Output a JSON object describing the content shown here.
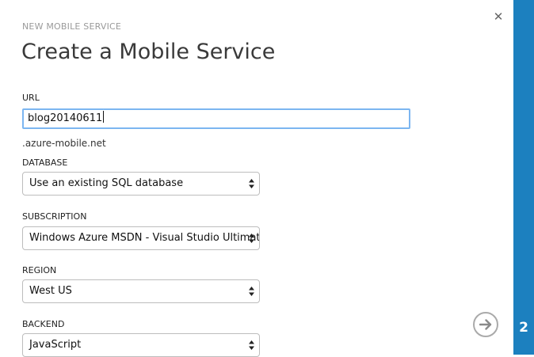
{
  "dialog": {
    "header": "NEW MOBILE SERVICE",
    "title": "Create a Mobile Service",
    "close_icon": "close-icon"
  },
  "form": {
    "url": {
      "label": "URL",
      "value": "blog20140611",
      "suffix": ".azure-mobile.net"
    },
    "database": {
      "label": "DATABASE",
      "selected": "Use an existing SQL database"
    },
    "subscription": {
      "label": "SUBSCRIPTION",
      "selected": "Windows Azure MSDN - Visual Studio Ultimate"
    },
    "region": {
      "label": "REGION",
      "selected": "West US"
    },
    "backend": {
      "label": "BACKEND",
      "selected": "JavaScript"
    }
  },
  "wizard": {
    "step": "2",
    "next_icon": "arrow-right-circle-icon"
  },
  "colors": {
    "accent": "#1c80bf",
    "focus_border": "#7cb6f1"
  }
}
